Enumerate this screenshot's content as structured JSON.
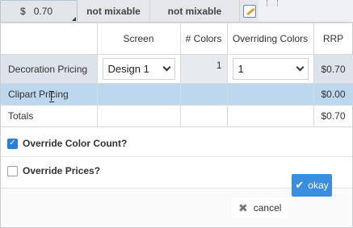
{
  "toolbar": {
    "price_symbol": "$",
    "price_value": "0.70",
    "col2": "not mixable",
    "col3": "not mixable",
    "edit_icon": "edit-icon"
  },
  "grid": {
    "headers": [
      "",
      "Screen",
      "# Colors",
      "Overriding Colors",
      "RRP"
    ],
    "rows": [
      {
        "label": "Decoration Pricing",
        "screen": "Design 1",
        "colors": "1",
        "overriding": "1",
        "rrp": "$0.70"
      },
      {
        "label": "Clipart Pricing",
        "screen": "",
        "colors": "",
        "overriding": "",
        "rrp": "$0.00"
      },
      {
        "label": "Totals",
        "screen": "",
        "colors": "",
        "overriding": "",
        "rrp": "$0.70"
      }
    ]
  },
  "options": {
    "override_color_count": {
      "label": "Override Color Count?",
      "checked": true
    },
    "override_prices": {
      "label": "Override Prices?",
      "checked": false
    }
  },
  "footer": {
    "cancel_label": "cancel",
    "okay_label": "okay"
  },
  "colors": {
    "accent": "#3a8ee0",
    "selected_row": "#bdd7ef"
  }
}
